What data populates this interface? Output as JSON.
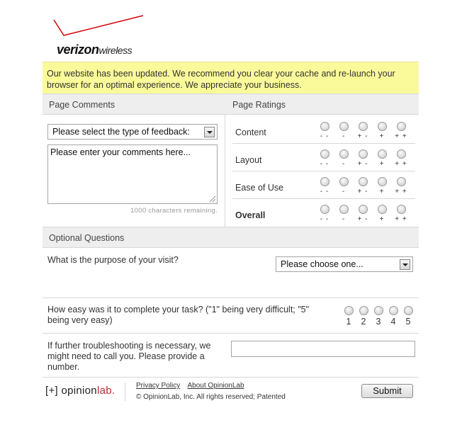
{
  "brand": {
    "name_bold": "verizon",
    "name_light": "wireless",
    "logo_accent_color": "#cd040b"
  },
  "notice": {
    "text": "Our website has been updated. We recommend you clear your cache and re-launch your browser for an optimal experience. We appreciate your business.",
    "background_color": "#fbfa9a"
  },
  "comments": {
    "header": "Page Comments",
    "feedback_select": "Please select the type of feedback:",
    "comment_placeholder": "Please enter your comments here...",
    "remaining": "1000 characters remaining."
  },
  "ratings": {
    "header": "Page Ratings",
    "scale": [
      "- -",
      "-",
      "+ -",
      "+",
      "+ +"
    ],
    "rows": [
      {
        "label": "Content",
        "bold": false
      },
      {
        "label": "Layout",
        "bold": false
      },
      {
        "label": "Ease of Use",
        "bold": false
      },
      {
        "label": "Overall",
        "bold": true
      }
    ]
  },
  "optional": {
    "header": "Optional Questions",
    "purpose_question": "What is the purpose of your visit?",
    "purpose_select": "Please choose one...",
    "ease_question": "How easy was it to complete your task? (\"1\" being very difficult; \"5\" being very easy)",
    "ease_scale": [
      "1",
      "2",
      "3",
      "4",
      "5"
    ],
    "phone_question": "If further troubleshooting is necessary, we might need to call you. Please provide a number.",
    "phone_value": ""
  },
  "footer": {
    "logo_bracket": "[+]",
    "logo_opinion": "opinion",
    "logo_lab": "lab.",
    "privacy_link": "Privacy Policy",
    "about_link": "About OpinionLab",
    "copyright": "© OpinionLab, Inc. All rights reserved; Patented",
    "submit_label": "Submit"
  }
}
